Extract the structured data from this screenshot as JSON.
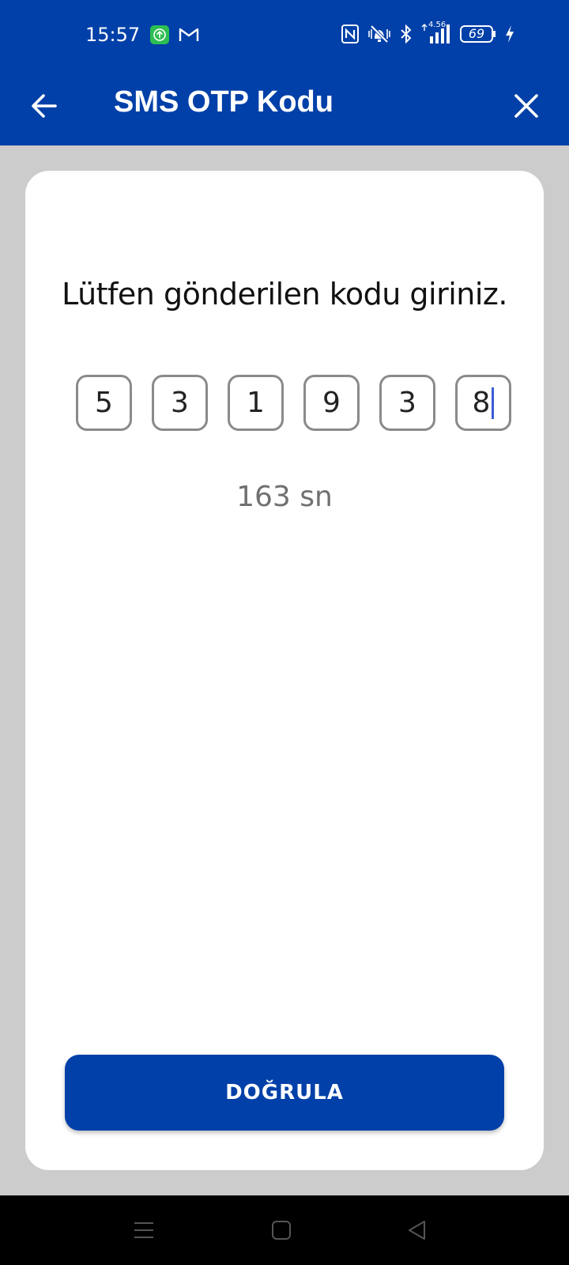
{
  "status_bar": {
    "time": "15:57",
    "battery": "69",
    "network_speed": "4.56",
    "icons": [
      "app-update-icon",
      "gmail-icon",
      "nfc-icon",
      "vibrate-off-icon",
      "bluetooth-icon",
      "signal-icon",
      "battery-icon",
      "charging-icon"
    ]
  },
  "app_bar": {
    "title": "SMS OTP Kodu",
    "back_icon": "arrow-left-icon",
    "close_icon": "close-icon"
  },
  "card": {
    "prompt": "Lütfen gönderilen kodu giriniz.",
    "otp_digits": [
      "5",
      "3",
      "1",
      "9",
      "3",
      "8"
    ],
    "timer": "163 sn",
    "verify_label": "DOĞRULA"
  },
  "colors": {
    "primary": "#0040a8",
    "background": "#cccccc",
    "card": "#ffffff",
    "caret": "#3b5bd6"
  },
  "nav_bar": {
    "icons": [
      "menu-icon",
      "home-icon",
      "back-triangle-icon"
    ]
  }
}
